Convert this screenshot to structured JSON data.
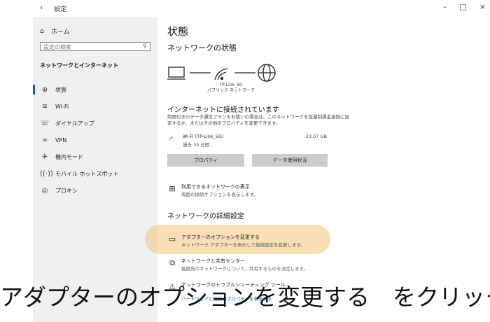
{
  "window": {
    "back": "‹",
    "title": "設定",
    "controls": [
      "–",
      "□",
      "×"
    ]
  },
  "sidebar": {
    "home": "ホーム",
    "search_placeholder": "設定の検索",
    "section": "ネットワークとインターネット",
    "items": [
      {
        "label": "状態",
        "icon": "status-icon",
        "active": true
      },
      {
        "label": "Wi-Fi",
        "icon": "wifi-icon"
      },
      {
        "label": "ダイヤルアップ",
        "icon": "dialup-icon"
      },
      {
        "label": "VPN",
        "icon": "vpn-icon"
      },
      {
        "label": "機内モード",
        "icon": "airplane-icon"
      },
      {
        "label": "モバイル ホットスポット",
        "icon": "hotspot-icon"
      },
      {
        "label": "プロキシ",
        "icon": "proxy-icon"
      }
    ]
  },
  "main": {
    "title": "状態",
    "network_status_heading": "ネットワークの状態",
    "network_name": "TP-Link_5G",
    "network_type": "パブリック ネットワーク",
    "connected_heading": "インターネットに接続されています",
    "connected_desc": "制限付きのデータ通信プランをお使いの場合は、このネットワークを従量制課金接続に設定するか、またはその他のプロパティを変更できます。",
    "wifi": {
      "name": "Wi-Fi (TP-Link_5G)",
      "sub": "過去 30 日間",
      "usage": "23.07 GB"
    },
    "btn_properties": "プロパティ",
    "btn_data_usage": "データ使用状況",
    "shared_title": "利用できるネットワークの表示",
    "shared_sub": "周囲の接続オプションを表示します。",
    "advanced_heading": "ネットワークの詳細設定",
    "adapter_title": "アダプターのオプションを変更する",
    "adapter_sub": "ネットワーク アダプターを表示して接続設定を変更します。",
    "sharing_title": "ネットワークと共有センター",
    "sharing_sub": "接続先のネットワークについて、共有するものを決定します。",
    "trouble_title": "ネットワークのトラブルシューティング ツール",
    "bottom_link": "ハードウェアと接続のプロパティを表示する"
  },
  "caption": "アダプターのオプションを変更する　をクリック",
  "colors": {
    "accent": "#0067c0",
    "highlight": "#f2c478",
    "sidebar_bg": "#f0f0f0",
    "button_bg": "#cccccc"
  }
}
